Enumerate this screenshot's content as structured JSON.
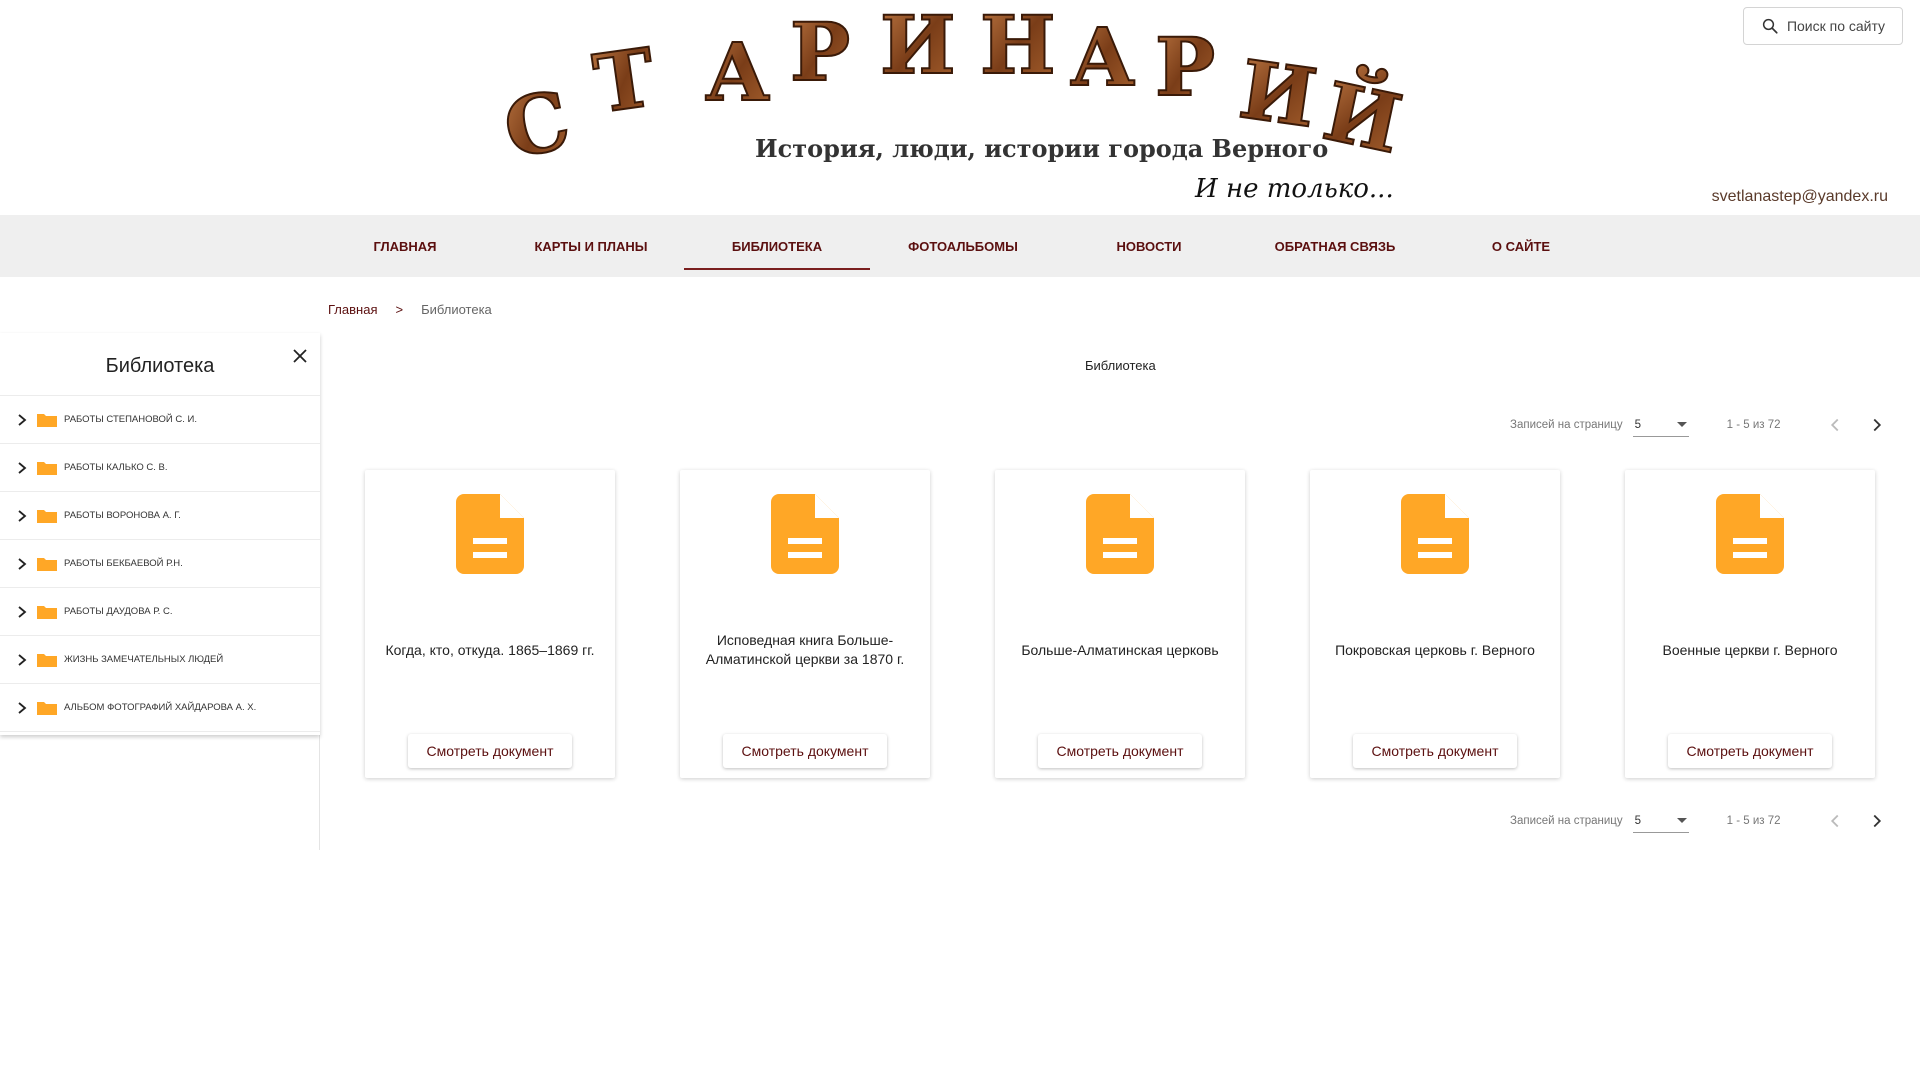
{
  "header": {
    "logo_text": "СТАРИНАРИЙ",
    "logo_subtitle": "История, люди, истории города Верного",
    "logo_tagline": "И не только...",
    "search_label": "Поиск по сайту",
    "email": "svetlanastep@yandex.ru",
    "icon": "search-icon"
  },
  "nav": {
    "items": [
      {
        "label": "ГЛАВНАЯ",
        "active": false
      },
      {
        "label": "КАРТЫ И ПЛАНЫ",
        "active": false
      },
      {
        "label": "БИБЛИОТЕКА",
        "active": true
      },
      {
        "label": "ФОТОАЛЬБОМЫ",
        "active": false
      },
      {
        "label": "НОВОСТИ",
        "active": false
      },
      {
        "label": "ОБРАТНАЯ СВЯЗЬ",
        "active": false
      },
      {
        "label": "О САЙТЕ",
        "active": false
      }
    ]
  },
  "breadcrumb": {
    "home": "Главная",
    "separator": ">",
    "current": "Библиотека"
  },
  "sidebar": {
    "title": "Библиотека",
    "items": [
      {
        "label": "РАБОТЫ СТЕПАНОВОЙ С. И."
      },
      {
        "label": "РАБОТЫ КАЛЬКО С. В."
      },
      {
        "label": "РАБОТЫ ВОРОНОВА А. Г."
      },
      {
        "label": "РАБОТЫ БЕКБАЕВОЙ Р.Н."
      },
      {
        "label": "РАБОТЫ ДАУДОВА Р. С."
      },
      {
        "label": "ЖИЗНЬ ЗАМЕЧАТЕЛЬНЫХ ЛЮДЕЙ"
      },
      {
        "label": "АЛЬБОМ ФОТОГРАФИЙ ХАЙДАРОВА А. Х."
      }
    ]
  },
  "main": {
    "title": "Библиотека",
    "paginator": {
      "label": "Записей на страницу",
      "page_size": "5",
      "range": "1 - 5 из 72"
    },
    "cards": [
      {
        "title": "Когда, кто, откуда. 1865–1869 гг.",
        "button": "Смотреть документ"
      },
      {
        "title": "Исповедная книга Больше-Алматинской церкви за 1870 г.",
        "button": "Смотреть документ"
      },
      {
        "title": "Больше-Алматинская церковь",
        "button": "Смотреть документ"
      },
      {
        "title": "Покровская церковь г. Верного",
        "button": "Смотреть документ"
      },
      {
        "title": "Военные церкви г. Верного",
        "button": "Смотреть документ"
      }
    ]
  },
  "colors": {
    "accent": "#5b0f0f",
    "folder": "#ffa726",
    "document": "#ffa726",
    "logo_wood": "#8a4a22"
  }
}
